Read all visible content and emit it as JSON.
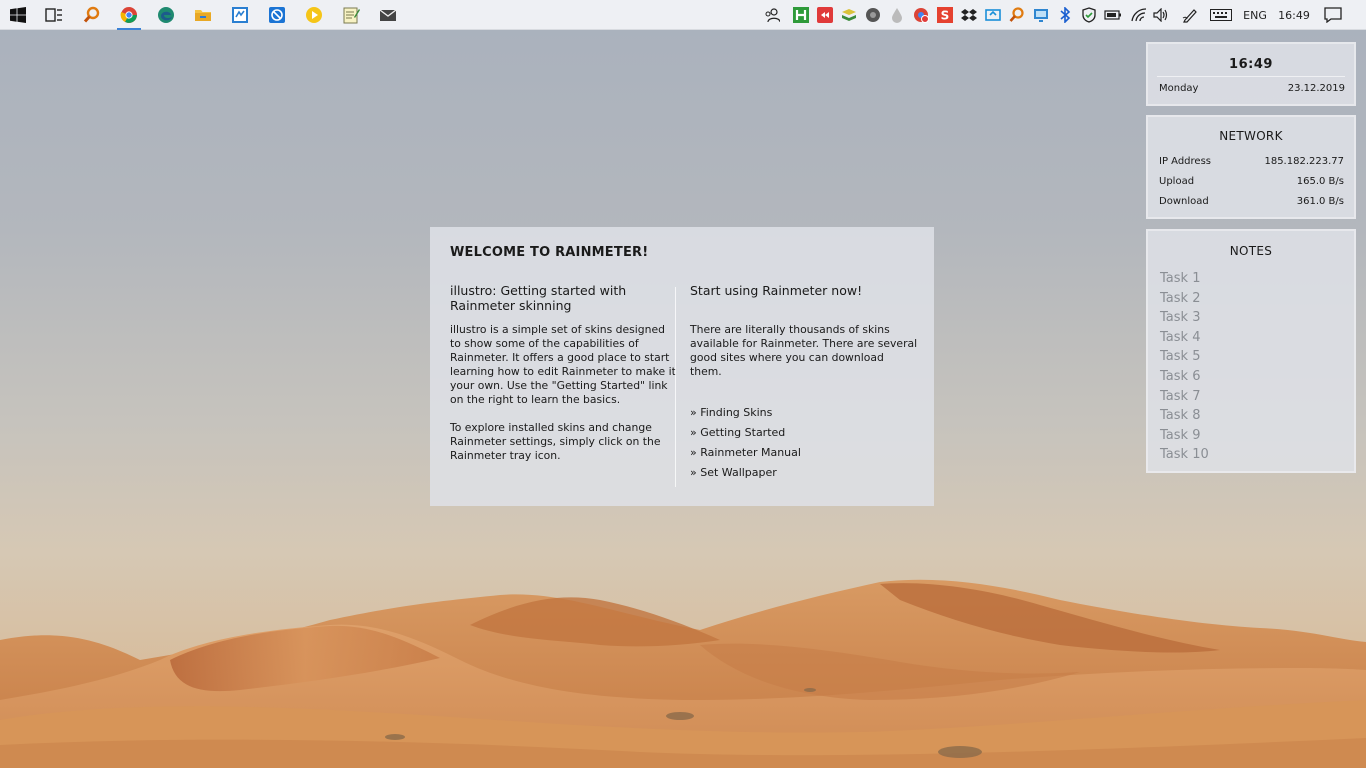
{
  "taskbar": {
    "apps": [
      {
        "icon": "windows-start-icon",
        "label": "Start"
      },
      {
        "icon": "task-view-icon",
        "label": "Task View"
      },
      {
        "icon": "search-tool-icon",
        "label": "Search tool"
      },
      {
        "icon": "chrome-icon",
        "label": "Google Chrome"
      },
      {
        "icon": "edge-icon",
        "label": "Microsoft Edge"
      },
      {
        "icon": "file-explorer-icon",
        "label": "File Explorer"
      },
      {
        "icon": "store-icon",
        "label": "App"
      },
      {
        "icon": "app-blue-circle-icon",
        "label": "App"
      },
      {
        "icon": "yellow-play-icon",
        "label": "Player"
      },
      {
        "icon": "notepad-icon",
        "label": "Notepad"
      },
      {
        "icon": "mail-icon",
        "label": "Mail"
      }
    ],
    "tray": {
      "language": "ENG",
      "time": "16:49"
    }
  },
  "clock": {
    "time": "16:49",
    "day": "Monday",
    "date": "23.12.2019"
  },
  "network": {
    "title": "NETWORK",
    "rows": [
      {
        "label": "IP Address",
        "value": "185.182.223.77"
      },
      {
        "label": "Upload",
        "value": "165.0 B/s"
      },
      {
        "label": "Download",
        "value": "361.0 B/s"
      }
    ]
  },
  "notes": {
    "title": "NOTES",
    "items": [
      "Task 1",
      "Task 2",
      "Task 3",
      "Task 4",
      "Task 5",
      "Task 6",
      "Task 7",
      "Task 8",
      "Task 9",
      "Task 10"
    ]
  },
  "welcome": {
    "title": "WELCOME TO RAINMETER!",
    "left_heading": "illustro: Getting started with Rainmeter skinning",
    "left_body_1": "illustro is a simple set of skins designed to show some of the capabilities of Rainmeter. It offers a good place to start learning how to edit Rainmeter to make it your own. Use the \"Getting Started\" link on the right to learn the basics.",
    "left_body_2": "To explore installed skins and change Rainmeter settings, simply click on the Rainmeter tray icon.",
    "right_heading": "Start using Rainmeter now!",
    "right_body": "There are literally thousands of skins available for Rainmeter. There are several good sites where you can download them.",
    "links": [
      "» Finding Skins",
      "» Getting Started",
      "» Rainmeter Manual",
      "» Set Wallpaper"
    ]
  },
  "colors": {
    "panel_bg": "#dee1e6",
    "taskbar_bg": "#eef0f4",
    "sand": "#d08d55",
    "sky": "#a9b1bd"
  }
}
